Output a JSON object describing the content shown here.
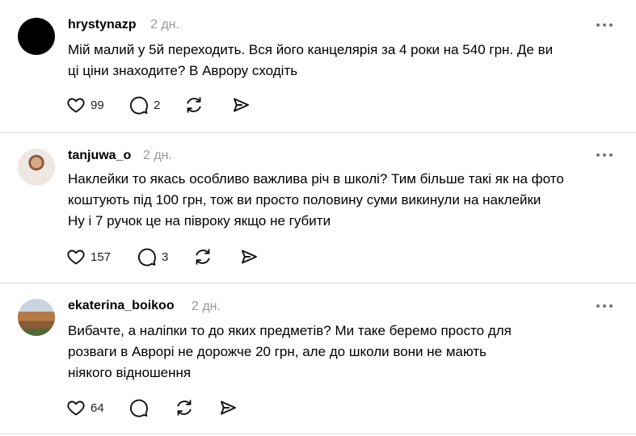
{
  "comments": [
    {
      "username": "hrystynazp",
      "time": "2 дн.",
      "lines": [
        "Мій малий у 5й переходить. Вся його канцелярія за 4 роки на 540 грн. Де ви",
        "ці ціни знаходите? В Аврору сходіть"
      ],
      "likes": "99",
      "replies": "2",
      "avatar": "black-circle"
    },
    {
      "username": "tanjuwa_o",
      "time": "2 дн.",
      "lines": [
        "Наклейки то якась особливо важлива річ в школі? Тим більше такі як на фото",
        "коштують під 100 грн, тож ви просто половину суми викинули на наклейки",
        "Ну і 7 ручок це на півроку якщо не губити"
      ],
      "likes": "157",
      "replies": "3",
      "avatar": "portrait-photo"
    },
    {
      "username": "ekaterina_boikoo",
      "time": "2 дн.",
      "lines": [
        "Вибачте, а наліпки то до яких предметів? Ми таке беремо просто для",
        "розваги в Аврорі не дорожче 20 грн, але до школи вони не мають",
        "ніякого відношення"
      ],
      "likes": "64",
      "replies": "",
      "avatar": "building-photo"
    }
  ],
  "icons": {
    "like": "heart-icon",
    "reply": "comment-bubble-icon",
    "repost": "repost-icon",
    "share": "send-icon",
    "more": "more-dots-icon"
  }
}
